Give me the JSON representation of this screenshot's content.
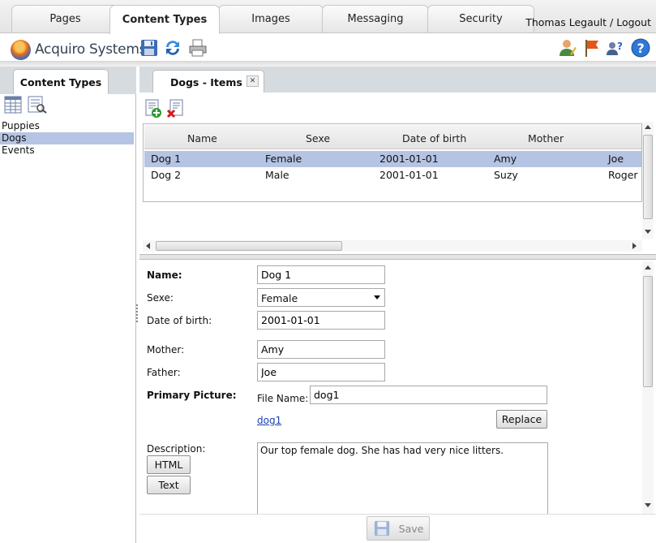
{
  "tabs": [
    {
      "label": "Pages"
    },
    {
      "label": "Content Types"
    },
    {
      "label": "Images"
    },
    {
      "label": "Messaging"
    },
    {
      "label": "Security"
    }
  ],
  "user_logout": "Thomas Legault / Logout",
  "logo_text": "Acquiro Systems",
  "left_panel": {
    "tab_label": "Content Types",
    "items": [
      "Puppies",
      "Dogs",
      "Events"
    ],
    "selected_index": 1
  },
  "right_panel": {
    "tab_label": "Dogs - Items",
    "close_glyph": "✕",
    "grid": {
      "columns": [
        "Name",
        "Sexe",
        "Date of birth",
        "Mother"
      ],
      "rows": [
        [
          "Dog 1",
          "Female",
          "2001-01-01",
          "Amy",
          "Joe"
        ],
        [
          "Dog 2",
          "Male",
          "2001-01-01",
          "Suzy",
          "Roger"
        ]
      ],
      "selected_row": 0
    },
    "form": {
      "name_label": "Name:",
      "name_value": "Dog 1",
      "sexe_label": "Sexe:",
      "sexe_value": "Female",
      "dob_label": "Date of birth:",
      "dob_value": "2001-01-01",
      "mother_label": "Mother:",
      "mother_value": "Amy",
      "father_label": "Father:",
      "father_value": "Joe",
      "picture_label": "Primary Picture:",
      "file_name_label": "File Name:",
      "file_name_value": "dog1",
      "file_link": "dog1",
      "replace_label": "Replace",
      "description_label": "Description:",
      "html_button": "HTML",
      "text_button": "Text",
      "description_value": "Our top female dog. She has had very nice litters.",
      "save_label": "Save"
    }
  },
  "colors": {
    "selection": "#b6c4e3",
    "header_bg": "#d6dbe0",
    "link": "#1a3fb5"
  }
}
